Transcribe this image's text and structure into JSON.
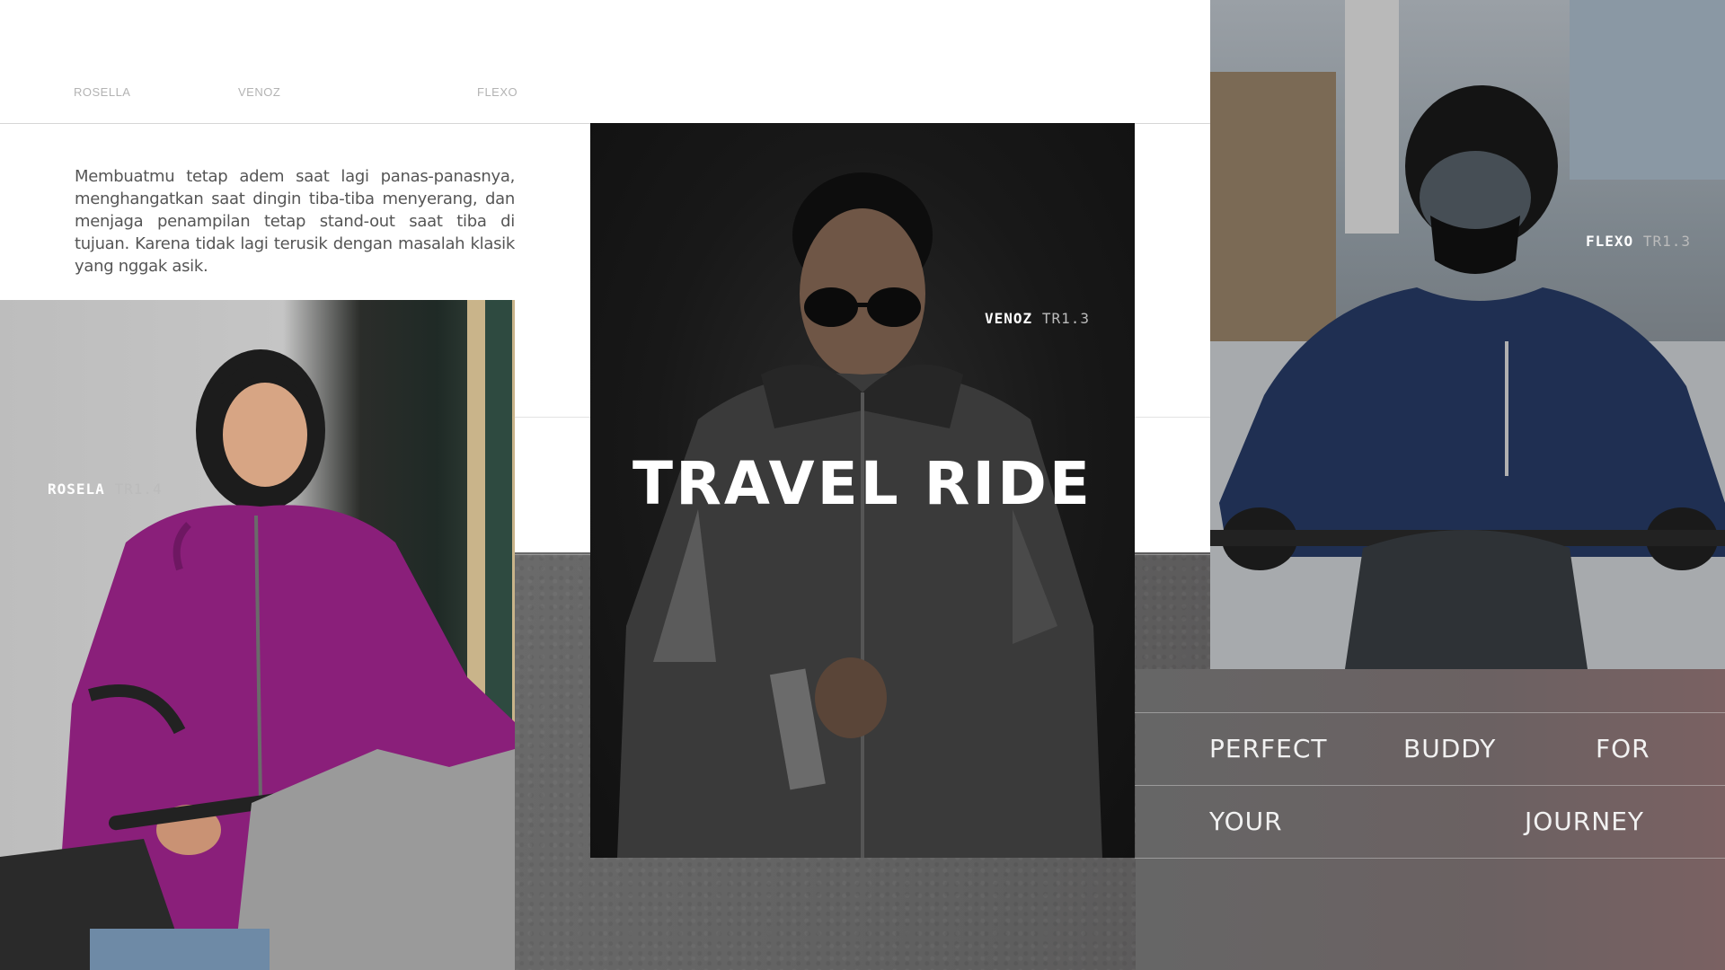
{
  "nav": {
    "items": [
      "ROSELLA",
      "VENOZ",
      "FLEXO"
    ]
  },
  "description": "Membuatmu tetap adem saat lagi panas-panasnya, menghangatkan saat dingin tiba-tiba menyerang, dan menjaga penampilan tetap stand-out saat tiba di tujuan. Karena tidak lagi terusik dengan masalah klasik yang nggak asik.",
  "products": [
    {
      "name": "ROSELA",
      "code": "TR1.4"
    },
    {
      "name": "VENOZ",
      "code": "TR1.3"
    },
    {
      "name": "FLEXO",
      "code": "TR1.3"
    }
  ],
  "brand": "TRAVEL RIDE",
  "tagline": {
    "row1": [
      "PERFECT",
      "BUDDY",
      "FOR"
    ],
    "row2": [
      "YOUR",
      "JOURNEY"
    ]
  },
  "colors": {
    "background": "#ffffff",
    "panel": "#5e5e5e",
    "text_light": "#f2f2f2",
    "jacket_rosela": "#8a1f7a",
    "jacket_flexo": "#1f2f52"
  }
}
